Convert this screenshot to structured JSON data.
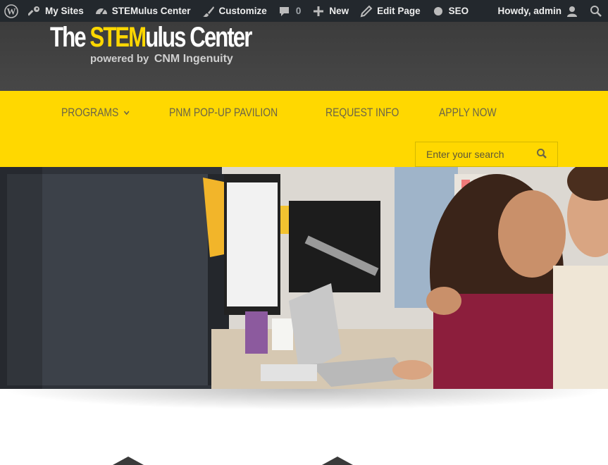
{
  "admin_bar": {
    "my_sites": "My Sites",
    "site_name": "STEMulus Center",
    "customize": "Customize",
    "comments_count": "0",
    "new": "New",
    "edit_page": "Edit Page",
    "seo": "SEO",
    "howdy": "Howdy, admin"
  },
  "logo": {
    "the": "The ",
    "stem": "STEM",
    "rest": "ulus Center",
    "powered_by": "powered by",
    "org": "CNM Ingenuity"
  },
  "nav": {
    "items": [
      {
        "label": "PROGRAMS"
      },
      {
        "label": "PNM POP-UP PAVILION"
      },
      {
        "label": "REQUEST INFO"
      },
      {
        "label": "APPLY NOW"
      }
    ]
  },
  "search": {
    "placeholder": "Enter your search"
  },
  "colors": {
    "admin_bar": "#23282d",
    "header": "#444444",
    "nav_accent": "#ffd800"
  }
}
